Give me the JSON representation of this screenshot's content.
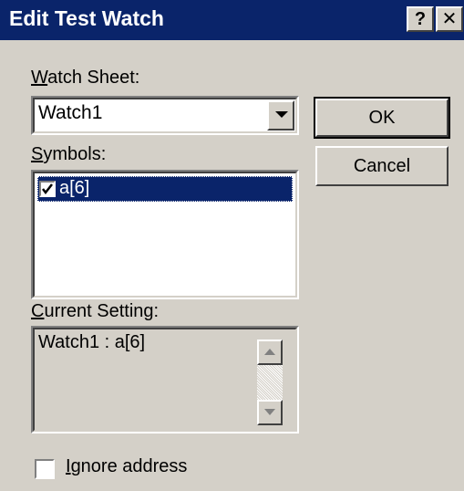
{
  "dialog": {
    "title": "Edit Test Watch",
    "help_button": "?",
    "close_button": "✕"
  },
  "watch_sheet": {
    "label_mnemonic": "W",
    "label_rest": "atch Sheet:",
    "value": "Watch1"
  },
  "buttons": {
    "ok": "OK",
    "cancel": "Cancel"
  },
  "symbols": {
    "label_mnemonic": "S",
    "label_rest": "ymbols:",
    "items": [
      {
        "label": "a[6]",
        "checked": true,
        "selected": true
      }
    ]
  },
  "current_setting": {
    "label_mnemonic": "C",
    "label_rest": "urrent Setting:",
    "value": "Watch1 : a[6]"
  },
  "ignore_address": {
    "label_mnemonic": "I",
    "label_rest": "gnore address",
    "checked": false
  },
  "colors": {
    "title_bar": "#0a246a",
    "face": "#d4d0c8",
    "selection": "#0a246a"
  },
  "icons": [
    "help-icon",
    "close-icon",
    "dropdown-arrow-icon",
    "checkmark-icon",
    "scroll-up-icon",
    "scroll-down-icon"
  ]
}
